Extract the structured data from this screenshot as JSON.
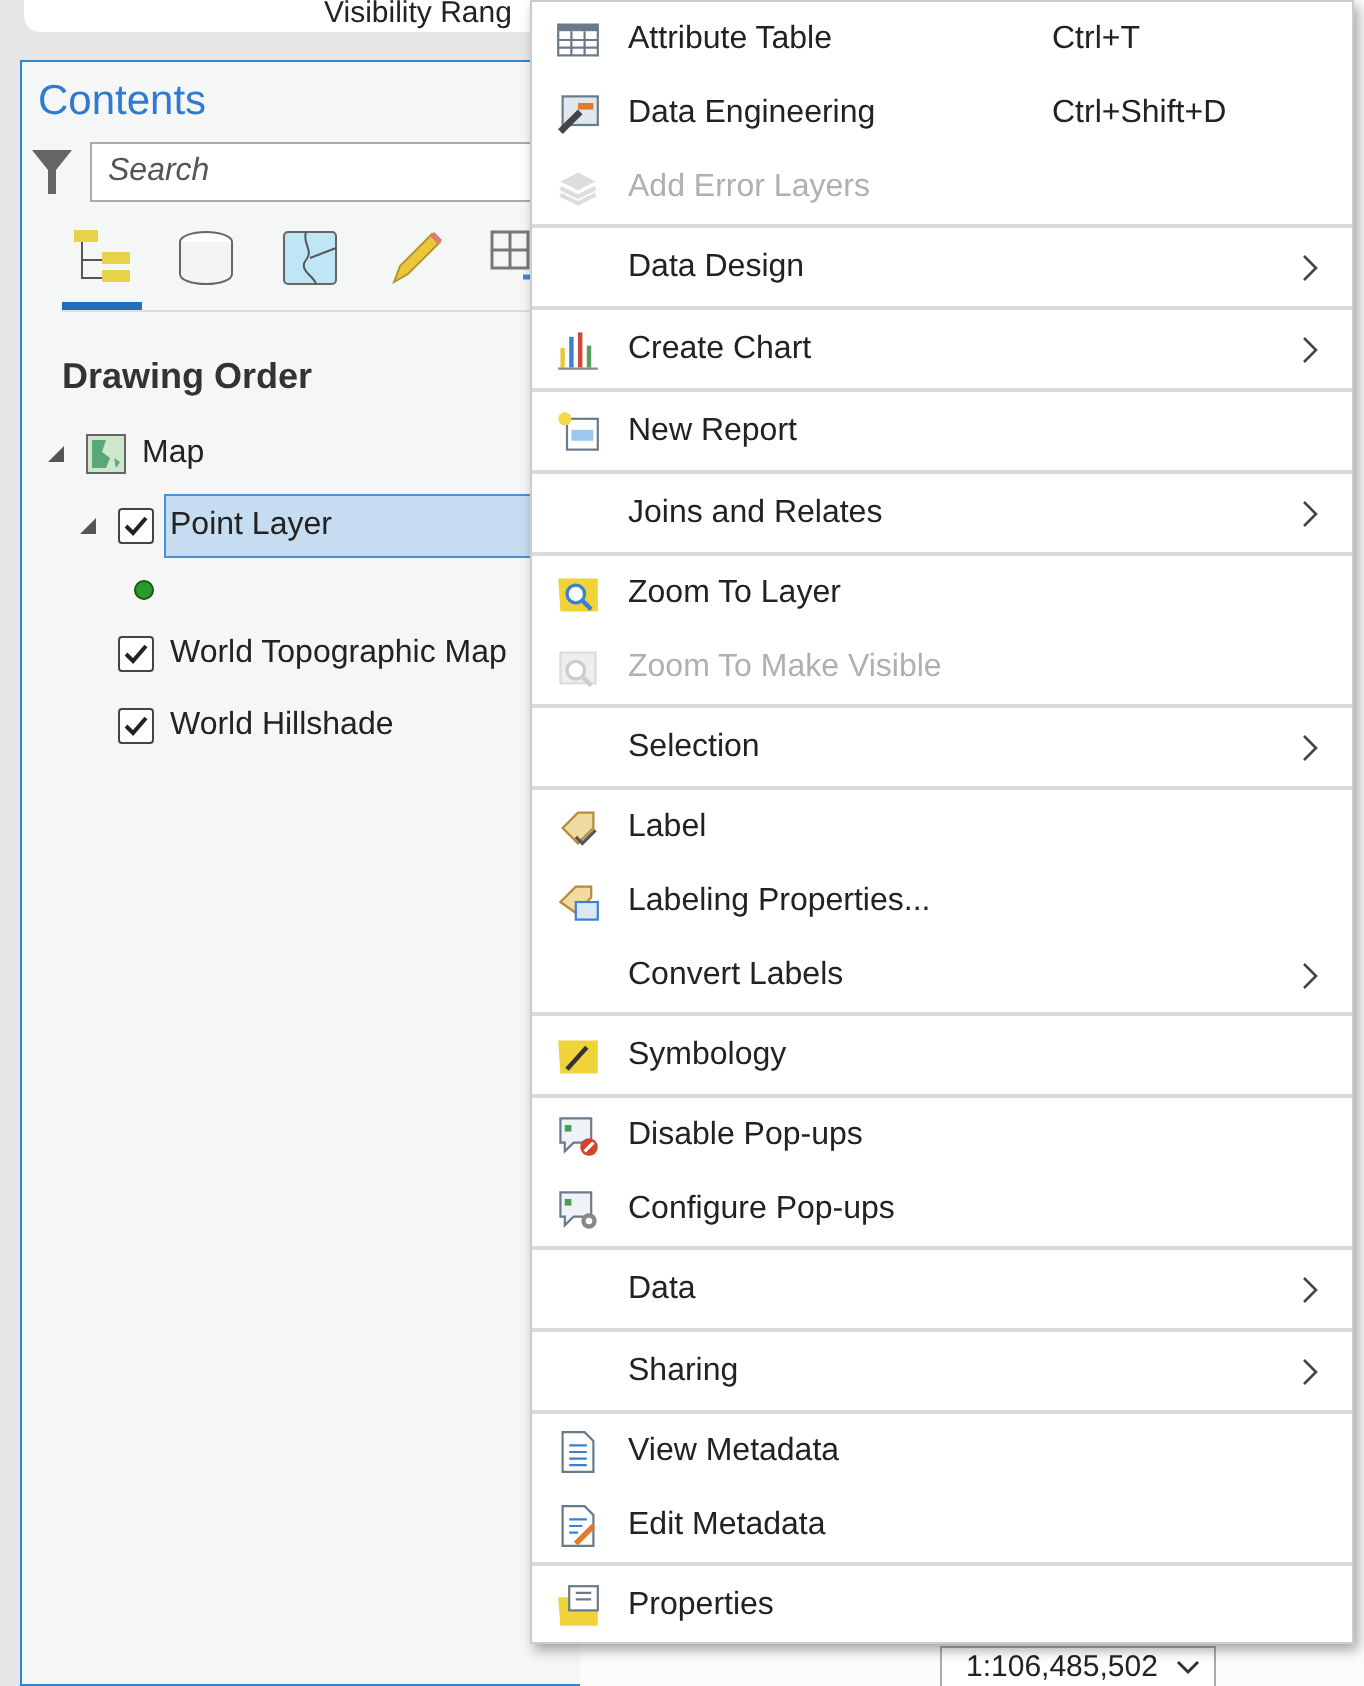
{
  "top_bar": {
    "label": "Visibility Rang"
  },
  "contents": {
    "title": "Contents",
    "search": {
      "placeholder": "Search"
    },
    "view_tabs": [
      {
        "selected": true
      },
      {
        "selected": false
      },
      {
        "selected": false
      },
      {
        "selected": false
      },
      {
        "selected": false
      }
    ],
    "heading": "Drawing Order",
    "tree": [
      {
        "kind": "map",
        "label": "Map",
        "expanded": true,
        "children": [
          {
            "kind": "layer",
            "label": "Point Layer",
            "checked": true,
            "selected": true,
            "expanded": true,
            "children": [
              {
                "kind": "point-symbol"
              }
            ]
          },
          {
            "kind": "layer",
            "label": "World Topographic Map",
            "checked": true,
            "selected": false
          },
          {
            "kind": "layer",
            "label": "World Hillshade",
            "checked": true,
            "selected": false
          }
        ]
      }
    ]
  },
  "context_menu": {
    "groups": [
      [
        {
          "label": "Attribute Table",
          "shortcut": "Ctrl+T",
          "disabled": false,
          "submenu": false
        },
        {
          "label": "Data Engineering",
          "shortcut": "Ctrl+Shift+D",
          "disabled": false,
          "submenu": false
        },
        {
          "label": "Add Error Layers",
          "disabled": true,
          "submenu": false
        }
      ],
      [
        {
          "label": "Data Design",
          "disabled": false,
          "submenu": true
        }
      ],
      [
        {
          "label": "Create Chart",
          "disabled": false,
          "submenu": true
        }
      ],
      [
        {
          "label": "New Report",
          "disabled": false,
          "submenu": false
        }
      ],
      [
        {
          "label": "Joins and Relates",
          "disabled": false,
          "submenu": true
        }
      ],
      [
        {
          "label": "Zoom To Layer",
          "disabled": false,
          "submenu": false
        },
        {
          "label": "Zoom To Make Visible",
          "disabled": true,
          "submenu": false
        }
      ],
      [
        {
          "label": "Selection",
          "disabled": false,
          "submenu": true
        }
      ],
      [
        {
          "label": "Label",
          "disabled": false,
          "submenu": false
        },
        {
          "label": "Labeling Properties...",
          "disabled": false,
          "submenu": false
        },
        {
          "label": "Convert Labels",
          "disabled": false,
          "submenu": true
        }
      ],
      [
        {
          "label": "Symbology",
          "disabled": false,
          "submenu": false
        }
      ],
      [
        {
          "label": "Disable Pop-ups",
          "disabled": false,
          "submenu": false
        },
        {
          "label": "Configure Pop-ups",
          "disabled": false,
          "submenu": false
        }
      ],
      [
        {
          "label": "Data",
          "disabled": false,
          "submenu": true
        }
      ],
      [
        {
          "label": "Sharing",
          "disabled": false,
          "submenu": true
        }
      ],
      [
        {
          "label": "View Metadata",
          "disabled": false,
          "submenu": false
        },
        {
          "label": "Edit Metadata",
          "disabled": false,
          "submenu": false
        }
      ],
      [
        {
          "label": "Properties",
          "disabled": false,
          "submenu": false
        }
      ]
    ]
  },
  "status_bar": {
    "scale": "1:106,485,502"
  }
}
